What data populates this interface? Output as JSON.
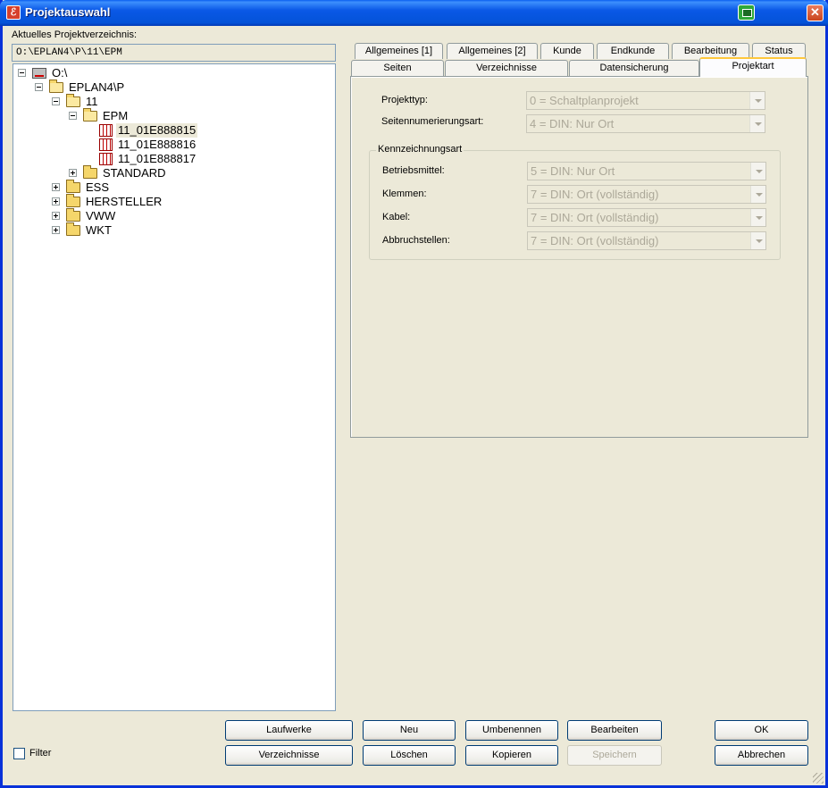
{
  "window": {
    "title": "Projektauswahl"
  },
  "left": {
    "path_label": "Aktuelles Projektverzeichnis:",
    "path_value": "O:\\EPLAN4\\P\\11\\EPM",
    "tree": {
      "root": "O:\\",
      "eplan": "EPLAN4\\P",
      "n11": "11",
      "epm": "EPM",
      "p1": "11_01E888815",
      "p2": "11_01E888816",
      "p3": "11_01E888817",
      "standard": "STANDARD",
      "ess": "ESS",
      "hersteller": "HERSTELLER",
      "vww": "VWW",
      "wkt": "WKT"
    },
    "filter_label": "Filter"
  },
  "tabs": {
    "row1": [
      "Allgemeines [1]",
      "Allgemeines [2]",
      "Kunde",
      "Endkunde",
      "Bearbeitung",
      "Status"
    ],
    "row2": [
      "Seiten",
      "Verzeichnisse",
      "Datensicherung",
      "Projektart"
    ],
    "active": "Projektart"
  },
  "projektart": {
    "projekttyp_label": "Projekttyp:",
    "projekttyp_value": "0 = Schaltplanprojekt",
    "seitennum_label": "Seitennumerierungsart:",
    "seitennum_value": "4 = DIN: Nur Ort",
    "group_label": "Kennzeichnungsart",
    "betriebsmittel_label": "Betriebsmittel:",
    "betriebsmittel_value": "5 = DIN: Nur Ort",
    "klemmen_label": "Klemmen:",
    "klemmen_value": "7 = DIN: Ort (vollständig)",
    "kabel_label": "Kabel:",
    "kabel_value": "7 = DIN: Ort (vollständig)",
    "abbruch_label": "Abbruchstellen:",
    "abbruch_value": "7 = DIN: Ort (vollständig)"
  },
  "buttons": {
    "laufwerke": "Laufwerke",
    "verzeichnisse": "Verzeichnisse",
    "neu": "Neu",
    "loeschen": "Löschen",
    "umbenennen": "Umbenennen",
    "kopieren": "Kopieren",
    "bearbeiten": "Bearbeiten",
    "speichern": "Speichern",
    "ok": "OK",
    "abbrechen": "Abbrechen"
  }
}
